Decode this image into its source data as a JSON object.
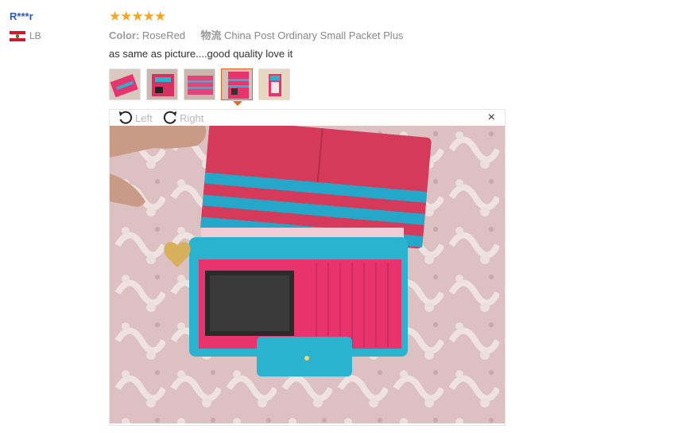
{
  "user": {
    "name": "R***r",
    "country": "LB"
  },
  "review": {
    "stars": "★★★★★",
    "color_label": "Color:",
    "color_value": "RoseRed",
    "shipping_label": "物流",
    "shipping_value": "China Post Ordinary Small Packet Plus",
    "feedback": "as same as picture....good quality love it"
  },
  "viewer": {
    "rotate_left": "Left",
    "rotate_right": "Right",
    "close": "×"
  },
  "colors": {
    "star": "#f5a623",
    "username": "#2a5db0",
    "active_thumb": "#e06b1f",
    "wallet_pink": "#e8336f",
    "wallet_blue": "#2ab3cf"
  },
  "thumbnails": [
    {
      "name": "thumb-1",
      "active": false
    },
    {
      "name": "thumb-2",
      "active": false
    },
    {
      "name": "thumb-3",
      "active": false
    },
    {
      "name": "thumb-4",
      "active": true
    },
    {
      "name": "thumb-5",
      "active": false
    }
  ]
}
